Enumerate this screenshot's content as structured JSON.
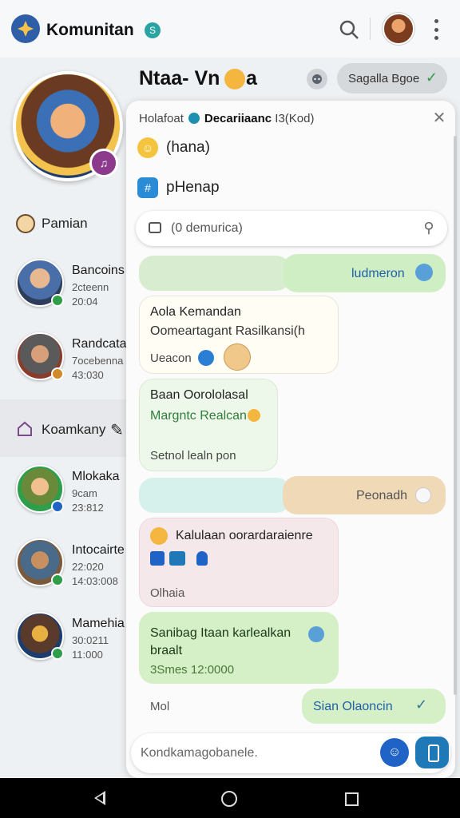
{
  "app": {
    "title": "Komunitan",
    "title_badge": "S"
  },
  "sidebar": {
    "section1": "Pamian",
    "section2": "Koamkany",
    "contacts": [
      {
        "name": "Bancoins",
        "line1": "2cteenn",
        "line2": "20:04"
      },
      {
        "name": "Randcata",
        "line1": "7ocebenna",
        "line2": "43:030"
      },
      {
        "name": "Mlokaka",
        "line1": "9cam",
        "line2": "23:812"
      },
      {
        "name": "Intocairte",
        "line1": "22:020",
        "line2": "14:03:008"
      },
      {
        "name": "Mamehia",
        "line1": "30:0211",
        "line2": "11:000"
      }
    ]
  },
  "chat": {
    "title_part1": "Ntaa- Vn",
    "title_part2": "a",
    "chip_label": "Sagalla Bgoe"
  },
  "popup": {
    "head_pre": "Holafoat",
    "head_bold": "Decariiaanc",
    "head_post": "I3(Kod)",
    "options": [
      "(hana)",
      "pHenap"
    ],
    "search_placeholder": "(0 demurica)"
  },
  "messages": [
    {
      "text": "ludmeron",
      "side": "right"
    },
    {
      "line1": "Aola Kemandan",
      "line2": "Oomeartagant Rasilkansi(h",
      "line3": "Ueacon",
      "side": "left"
    },
    {
      "line1": "Baan Oorololasal",
      "line2": "Margntc Realcan",
      "line3": "Setnol lealn pon",
      "side": "left"
    },
    {
      "text": "Peonadh",
      "side": "right"
    },
    {
      "line1": "Kalulaan oorardaraienre",
      "line3": "Olhaia",
      "side": "left"
    },
    {
      "line1": "Sanibag Itaan karlealkan",
      "line2": "braalt",
      "line3": "3Smes 12:0000",
      "side": "left"
    },
    {
      "text": "Sian  Olaoncin",
      "side": "right",
      "left_text": "Mol"
    }
  ],
  "composer": {
    "placeholder": "Kondkamagobanele."
  },
  "colors": {
    "accent": "#1f63c6",
    "bubble_green": "#d5efc6",
    "bubble_beige": "#efd9b7",
    "bubble_pink": "#f5e8ea"
  }
}
